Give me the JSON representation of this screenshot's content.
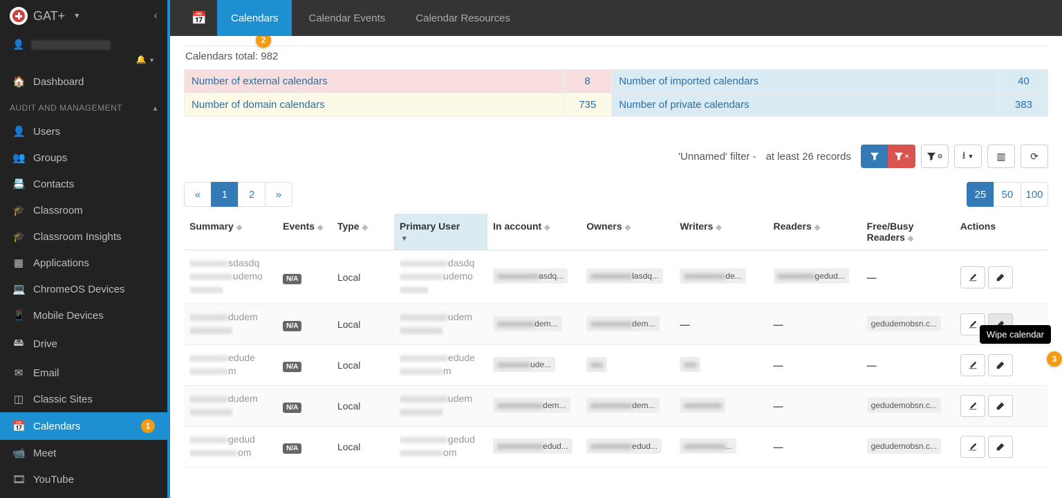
{
  "app": {
    "name": "GAT+"
  },
  "sidebar": {
    "dashboard": "Dashboard",
    "section": "AUDIT AND MANAGEMENT",
    "items": [
      {
        "label": "Users"
      },
      {
        "label": "Groups"
      },
      {
        "label": "Contacts"
      },
      {
        "label": "Classroom"
      },
      {
        "label": "Classroom Insights"
      },
      {
        "label": "Applications"
      },
      {
        "label": "ChromeOS Devices"
      },
      {
        "label": "Mobile Devices"
      },
      {
        "label": "Drive"
      },
      {
        "label": "Email"
      },
      {
        "label": "Classic Sites"
      },
      {
        "label": "Calendars"
      },
      {
        "label": "Meet"
      },
      {
        "label": "YouTube"
      }
    ],
    "step1": "1"
  },
  "tabs": {
    "calendars": "Calendars",
    "events": "Calendar Events",
    "resources": "Calendar Resources",
    "step2": "2"
  },
  "summary": {
    "total_label": "Calendars total:",
    "total_value": "982",
    "external_label": "Number of external calendars",
    "external_value": "8",
    "imported_label": "Number of imported calendars",
    "imported_value": "40",
    "domain_label": "Number of domain calendars",
    "domain_value": "735",
    "private_label": "Number of private calendars",
    "private_value": "383"
  },
  "filter": {
    "label": "'Unnamed' filter -",
    "hint": "at least 26 records"
  },
  "pager": {
    "prev": "«",
    "p1": "1",
    "p2": "2",
    "next": "»",
    "ps25": "25",
    "ps50": "50",
    "ps100": "100"
  },
  "cols": {
    "summary": "Summary",
    "events": "Events",
    "type": "Type",
    "primary_user": "Primary User",
    "in_account": "In account",
    "owners": "Owners",
    "writers": "Writers",
    "readers": "Readers",
    "freebusy": "Free/Busy Readers",
    "actions": "Actions"
  },
  "rows": [
    {
      "summary_blur": "xxxxxxxx",
      "summary_suffix": "sdasdq",
      "summary_blur2": "xxxxxxxxx",
      "summary_suffix2": "udemo",
      "summary_blur3": "xxxxxxx",
      "summary_suffix3": "",
      "events": "N/A",
      "type": "Local",
      "pu_blur": "xxxxxxxxxx",
      "pu_suffix": "dasdq",
      "pu_blur2": "xxxxxxxxx",
      "pu_suffix2": "udemo",
      "pu_blur3": "xxxxxx",
      "pu_suffix3": "",
      "acct_blur": "xxxxxxxxxx",
      "acct_suffix": "asdq...",
      "own_blur": "xxxxxxxxxx",
      "own_suffix": "lasdq...",
      "wri_blur": "xxxxxxxxxx",
      "wri_suffix": "de...",
      "rd_blur": "xxxxxxxxx",
      "rd_suffix": "gedud...",
      "freebusy": "—"
    },
    {
      "summary_blur": "xxxxxxxx",
      "summary_suffix": "dudem",
      "summary_blur2": "xxxxxxxxx",
      "summary_suffix2": "",
      "events": "N/A",
      "type": "Local",
      "pu_blur": "xxxxxxxxxx",
      "pu_suffix": "udem",
      "pu_blur2": "xxxxxxxxx",
      "pu_suffix2": "",
      "acct_blur": "xxxxxxxxx",
      "acct_suffix": "dem...",
      "own_blur": "xxxxxxxxxx",
      "own_suffix": "dem...",
      "writers": "—",
      "readers": "—",
      "freebusy": "gedudemobsn.c..."
    },
    {
      "summary_blur": "xxxxxxxx",
      "summary_suffix": "edude",
      "summary_blur2": "xxxxxxxx",
      "summary_suffix2": "m",
      "events": "N/A",
      "type": "Local",
      "pu_blur": "xxxxxxxxxx",
      "pu_suffix": "edude",
      "pu_blur2": "xxxxxxxxx",
      "pu_suffix2": "m",
      "acct_blur": "xxxxxxxx",
      "acct_suffix": "ude...",
      "own_blur": "xxx",
      "own_suffix": "",
      "wri_blur": "xxx",
      "wri_suffix": "",
      "readers": "—",
      "freebusy": "—"
    },
    {
      "summary_blur": "xxxxxxxx",
      "summary_suffix": "dudem",
      "summary_blur2": "xxxxxxxxx",
      "summary_suffix2": "",
      "events": "N/A",
      "type": "Local",
      "pu_blur": "xxxxxxxxxx",
      "pu_suffix": "udem",
      "pu_blur2": "xxxxxxxxx",
      "pu_suffix2": "",
      "acct_blur": "xxxxxxxxxxx",
      "acct_suffix": "dem...",
      "own_blur": "xxxxxxxxxx",
      "own_suffix": "dem...",
      "wri_blur": "xxxxxxxxx",
      "wri_suffix": "",
      "readers": "—",
      "freebusy": "gedudemobsn.c..."
    },
    {
      "summary_blur": "xxxxxxxx",
      "summary_suffix": "gedud",
      "summary_blur2": "xxxxxxxxxx",
      "summary_suffix2": "om",
      "events": "N/A",
      "type": "Local",
      "pu_blur": "xxxxxxxxxx",
      "pu_suffix": "gedud",
      "pu_blur2": "xxxxxxxxx",
      "pu_suffix2": "om",
      "acct_blur": "xxxxxxxxxxx",
      "acct_suffix": "edud...",
      "own_blur": "xxxxxxxxxx",
      "own_suffix": "edud...",
      "wri_blur": "xxxxxxxxxx",
      "wri_suffix": "...",
      "readers": "—",
      "freebusy": "gedudemobsn.c..."
    }
  ],
  "tooltip": {
    "wipe": "Wipe calendar",
    "step3": "3"
  }
}
